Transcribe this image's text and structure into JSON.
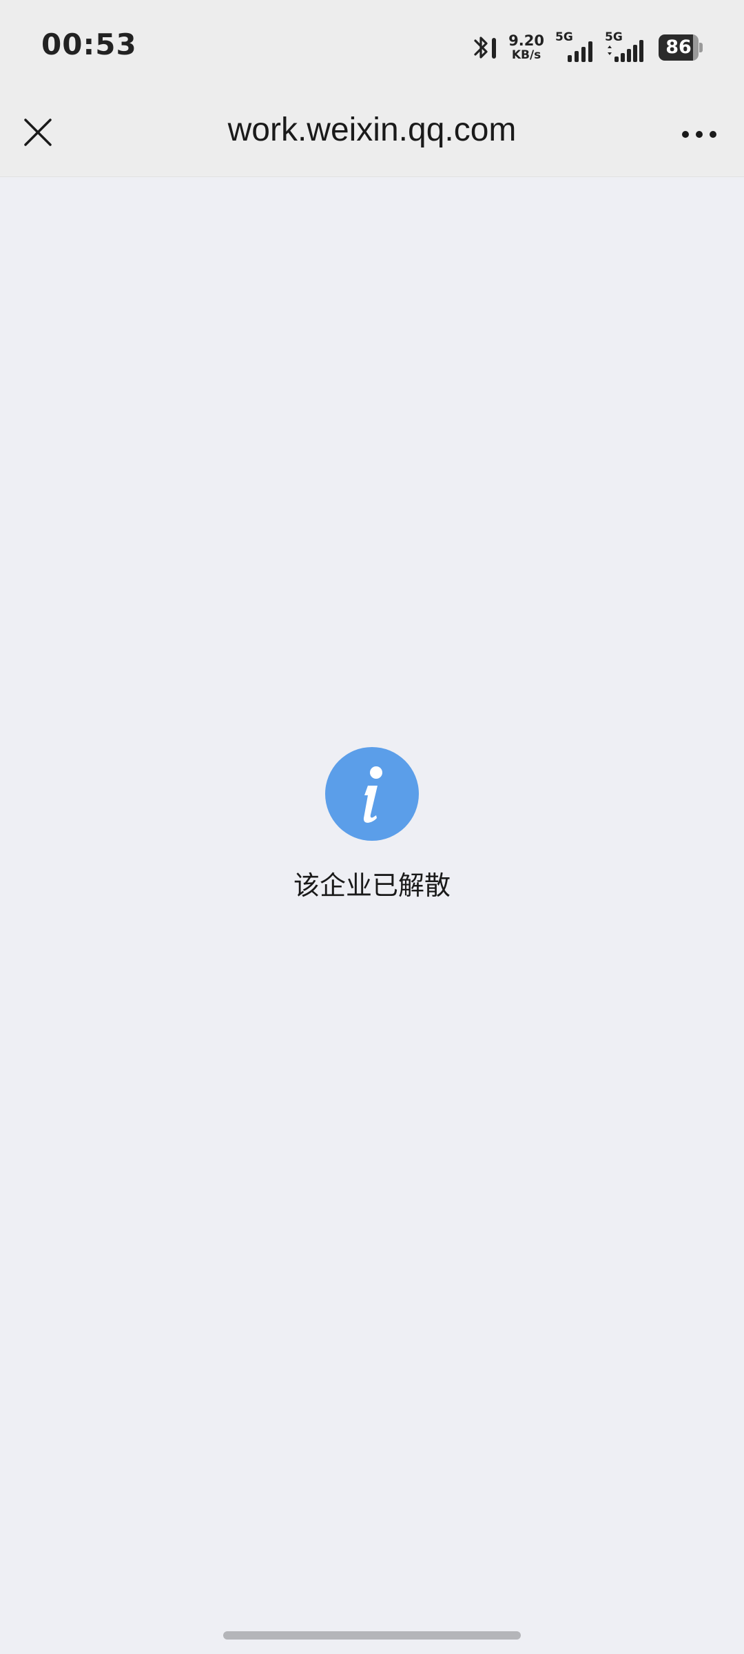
{
  "status_bar": {
    "time": "00:53",
    "net_speed_value": "9.20",
    "net_speed_unit": "KB/s",
    "sim1_label": "5G",
    "sim2_label": "5G",
    "battery_level": "86",
    "icons": [
      "bluetooth-icon",
      "signal-icon",
      "signal-icon",
      "battery-icon"
    ]
  },
  "nav_bar": {
    "title": "work.weixin.qq.com",
    "icons": [
      "close-icon",
      "more-icon"
    ]
  },
  "content": {
    "icon": "info-icon",
    "icon_color": "#5b9ee9",
    "message": "该企业已解散"
  }
}
